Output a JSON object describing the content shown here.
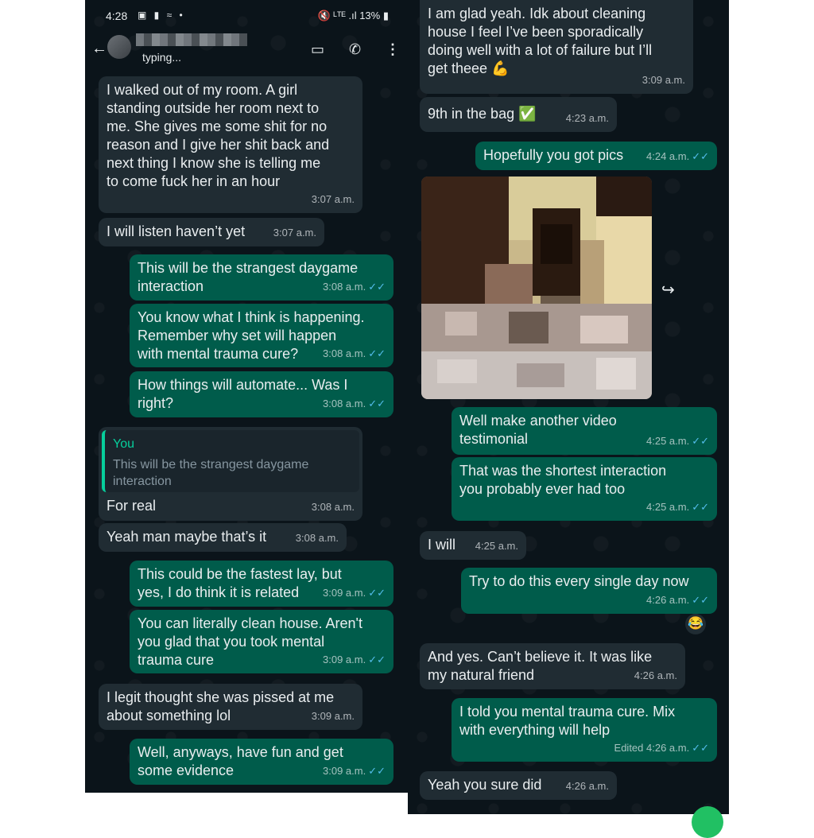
{
  "status": {
    "time": "4:28",
    "left_icons": "▣ ▮ ≈ •",
    "right_icons": "🔇 ᴸᵀᴱ .ıl 13% ▮"
  },
  "header": {
    "typing": "typing...",
    "back_icon": "←",
    "video_icon": "▭",
    "call_icon": "✆",
    "menu_icon": "⋮"
  },
  "left_messages": [
    {
      "dir": "in",
      "text": "I walked out of my room. A girl\nstanding outside her room next to\nme. She gives me some shit for no\nreason and I give her shit back and\nnext thing I know she is telling me\nto come fuck her in an hour",
      "time": "3:07 a.m."
    },
    {
      "dir": "in",
      "text": "I will listen haven’t yet",
      "time": "3:07 a.m."
    },
    {
      "dir": "out",
      "text": "This will be the strangest daygame\ninteraction",
      "time": "3:08 a.m."
    },
    {
      "dir": "out",
      "text": "You know what I think is happening.\nRemember why set will happen\nwith mental trauma cure?",
      "time": "3:08 a.m."
    },
    {
      "dir": "out",
      "text": "How things will automate... Was I\nright?",
      "time": "3:08 a.m."
    },
    {
      "dir": "in",
      "quote_author": "You",
      "quote_text": "This will be the strangest daygame\ninteraction",
      "text": "For real",
      "time": "3:08 a.m."
    },
    {
      "dir": "in",
      "text": "Yeah man maybe that’s it",
      "time": "3:08 a.m."
    },
    {
      "dir": "out",
      "text": "This could be the fastest lay, but\nyes, I do think it is related",
      "time": "3:09 a.m."
    },
    {
      "dir": "out",
      "text": "You can literally clean house. Aren't\nyou glad that you took mental\ntrauma cure",
      "time": "3:09 a.m."
    },
    {
      "dir": "in",
      "text": "I legit thought she was pissed at me\nabout something lol",
      "time": "3:09 a.m."
    },
    {
      "dir": "out",
      "text": "Well, anyways, have fun and get\nsome evidence",
      "time": "3:09 a.m."
    }
  ],
  "right_messages": [
    {
      "dir": "in",
      "text": "I am glad yeah. Idk about cleaning\nhouse I feel I’ve been sporadically\ndoing well with a lot of failure but I’ll\nget theee",
      "emoji": "💪",
      "time": "3:09 a.m."
    },
    {
      "dir": "in",
      "text": "9th in the bag",
      "emoji": "✅",
      "time": "4:23 a.m."
    },
    {
      "dir": "out",
      "text": "Hopefully you got pics",
      "time": "4:24 a.m."
    },
    {
      "dir": "out",
      "text": "Well make another video\ntestimonial",
      "time": "4:25 a.m."
    },
    {
      "dir": "out",
      "text": "That was the shortest interaction\nyou probably ever had too",
      "time": "4:25 a.m."
    },
    {
      "dir": "in",
      "text": "I will",
      "time": "4:25 a.m."
    },
    {
      "dir": "out",
      "text": "Try to do this every single day now",
      "time": "4:26 a.m.",
      "reaction": "😂"
    },
    {
      "dir": "in",
      "text": "And yes. Can’t believe it. It was like\nmy natural friend",
      "time": "4:26 a.m."
    },
    {
      "dir": "out",
      "text": "I told you mental trauma cure. Mix\nwith everything will help",
      "time": "Edited 4:26 a.m."
    },
    {
      "dir": "in",
      "text": "Yeah you sure did",
      "time": "4:26 a.m."
    }
  ],
  "forward_icon": "↪",
  "tick": "✓✓"
}
